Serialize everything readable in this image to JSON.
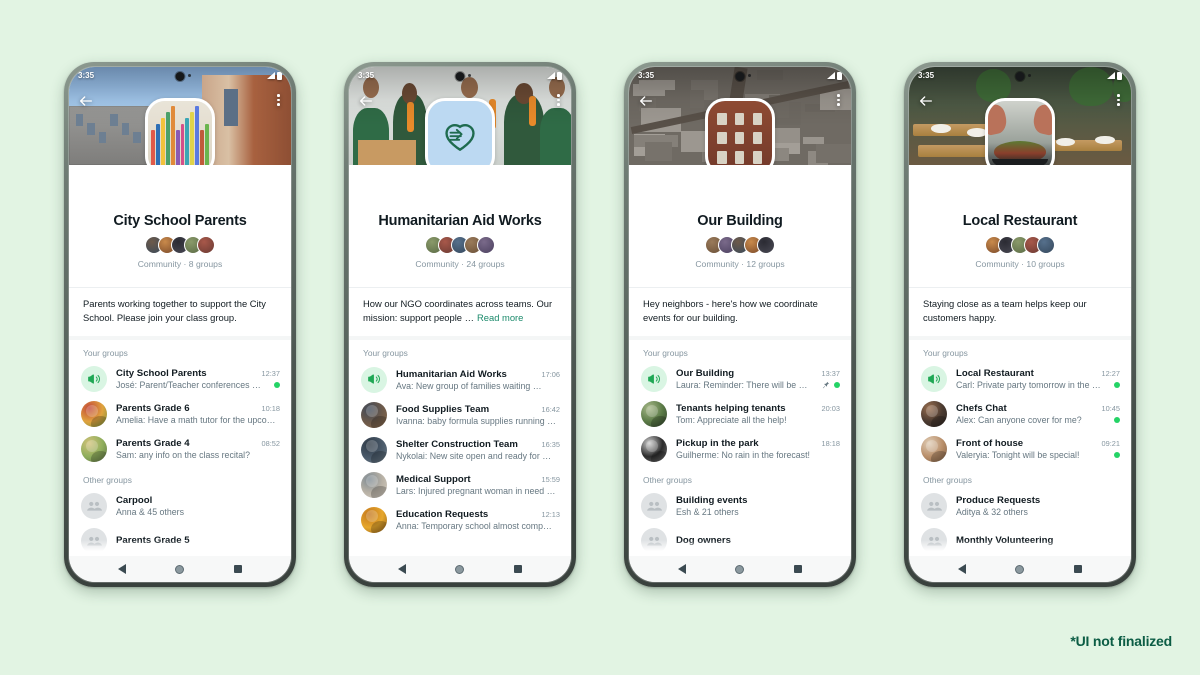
{
  "caption": "*UI not finalized",
  "theme": {
    "page_background": "#e2f4e3",
    "accent_green": "#25d366",
    "link_green": "#1b8a6b",
    "caption_green": "#0b5c44",
    "title_color": "#111b21",
    "muted_color": "#8696a0"
  },
  "labels": {
    "your_groups": "Your groups",
    "other_groups": "Other groups",
    "read_more": "Read more",
    "status_time": "3:35"
  },
  "phones": [
    {
      "status_time": "3:35",
      "community_name": "City School Parents",
      "meta": "Community · 8 groups",
      "description": "Parents working together to support the City School. Please join your class group.",
      "has_read_more": false,
      "sections": [
        {
          "header": "Your groups",
          "rows": [
            {
              "title": "City School Parents",
              "subtitle": "José: Parent/Teacher conferences …",
              "time": "12:37",
              "avatar": "announcement",
              "unread": true,
              "pinned": false
            },
            {
              "title": "Parents Grade 6",
              "subtitle": "Amelia: Have a math tutor for the upco…",
              "time": "10:18",
              "avatar": "photo-a",
              "unread": false,
              "pinned": false
            },
            {
              "title": "Parents Grade 4",
              "subtitle": "Sam: any info on the class recital?",
              "time": "08:52",
              "avatar": "photo-b",
              "unread": false,
              "pinned": false
            }
          ]
        },
        {
          "header": "Other groups",
          "rows": [
            {
              "title": "Carpool",
              "subtitle": "Anna & 45 others",
              "time": "",
              "avatar": "placeholder",
              "unread": false,
              "pinned": false
            },
            {
              "title": "Parents Grade 5",
              "subtitle": "",
              "time": "",
              "avatar": "placeholder",
              "unread": false,
              "pinned": false
            }
          ]
        }
      ]
    },
    {
      "status_time": "3:35",
      "community_name": "Humanitarian Aid Works",
      "meta": "Community · 24 groups",
      "description": "How our NGO coordinates across teams. Our mission: support people …",
      "has_read_more": true,
      "sections": [
        {
          "header": "Your groups",
          "rows": [
            {
              "title": "Humanitarian Aid Works",
              "subtitle": "Ava: New group of families waiting …",
              "time": "17:06",
              "avatar": "announcement",
              "unread": false,
              "pinned": false
            },
            {
              "title": "Food Supplies Team",
              "subtitle": "Ivanna: baby formula supplies running …",
              "time": "16:42",
              "avatar": "photo-c",
              "unread": false,
              "pinned": false
            },
            {
              "title": "Shelter Construction Team",
              "subtitle": "Nykolai: New site open and ready for …",
              "time": "16:35",
              "avatar": "photo-d",
              "unread": false,
              "pinned": false
            },
            {
              "title": "Medical Support",
              "subtitle": "Lars: Injured pregnant woman in need …",
              "time": "15:59",
              "avatar": "photo-e",
              "unread": false,
              "pinned": false
            },
            {
              "title": "Education Requests",
              "subtitle": "Anna: Temporary school almost comp…",
              "time": "12:13",
              "avatar": "photo-f",
              "unread": false,
              "pinned": false
            }
          ]
        }
      ]
    },
    {
      "status_time": "3:35",
      "community_name": "Our Building",
      "meta": "Community · 12 groups",
      "description": "Hey neighbors - here's how we coordinate events for our building.",
      "has_read_more": false,
      "sections": [
        {
          "header": "Your groups",
          "rows": [
            {
              "title": "Our Building",
              "subtitle": "Laura: Reminder:  There will be …",
              "time": "13:37",
              "avatar": "announcement",
              "unread": true,
              "pinned": true
            },
            {
              "title": "Tenants helping tenants",
              "subtitle": "Tom: Appreciate all the help!",
              "time": "20:03",
              "avatar": "photo-g",
              "unread": false,
              "pinned": false
            },
            {
              "title": "Pickup in the park",
              "subtitle": "Guilherme: No rain in the forecast!",
              "time": "18:18",
              "avatar": "photo-h",
              "unread": false,
              "pinned": false
            }
          ]
        },
        {
          "header": "Other groups",
          "rows": [
            {
              "title": "Building events",
              "subtitle": "Esh & 21 others",
              "time": "",
              "avatar": "placeholder",
              "unread": false,
              "pinned": false
            },
            {
              "title": "Dog owners",
              "subtitle": "",
              "time": "",
              "avatar": "placeholder",
              "unread": false,
              "pinned": false
            }
          ]
        }
      ]
    },
    {
      "status_time": "3:35",
      "community_name": "Local Restaurant",
      "meta": "Community · 10 groups",
      "description": "Staying close as a team helps keep our customers happy.",
      "has_read_more": false,
      "sections": [
        {
          "header": "Your groups",
          "rows": [
            {
              "title": "Local Restaurant",
              "subtitle": "Carl: Private party tomorrow in the …",
              "time": "12:27",
              "avatar": "announcement",
              "unread": true,
              "pinned": false
            },
            {
              "title": "Chefs Chat",
              "subtitle": "Alex: Can anyone cover for me?",
              "time": "10:45",
              "avatar": "photo-i",
              "unread": true,
              "pinned": false
            },
            {
              "title": "Front of house",
              "subtitle": "Valeryia: Tonight will be special!",
              "time": "09:21",
              "avatar": "photo-j",
              "unread": true,
              "pinned": false
            }
          ]
        },
        {
          "header": "Other groups",
          "rows": [
            {
              "title": "Produce Requests",
              "subtitle": "Aditya & 32 others",
              "time": "",
              "avatar": "placeholder",
              "unread": false,
              "pinned": false
            },
            {
              "title": "Monthly Volunteering",
              "subtitle": "",
              "time": "",
              "avatar": "placeholder",
              "unread": false,
              "pinned": false
            }
          ]
        }
      ]
    }
  ]
}
